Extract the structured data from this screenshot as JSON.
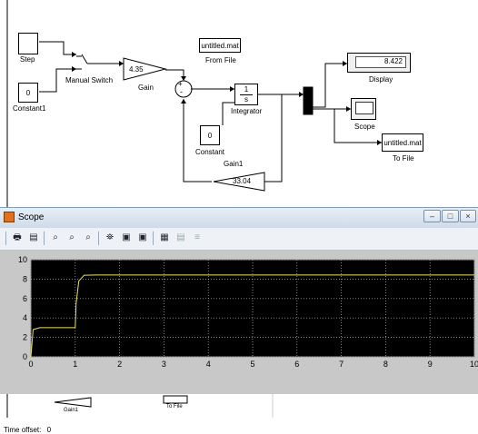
{
  "diagram": {
    "blocks": {
      "step": "Step",
      "constant1_value": "0",
      "constant1": "Constant1",
      "manual_switch": "Manual Switch",
      "gain_value": "4.35",
      "gain": "Gain",
      "from_file_value": "untitled.mat",
      "from_file": "From File",
      "integrator_num": "1",
      "integrator_den": "s",
      "integrator": "Integrator",
      "constant_value": "0",
      "constant": "Constant",
      "gain1_value": "33.04",
      "gain1": "Gain1",
      "display_value": "8.422",
      "display": "Display",
      "scope": "Scope",
      "to_file_value": "untitled.mat",
      "to_file": "To File"
    }
  },
  "scope_window": {
    "title": "Scope",
    "buttons": {
      "minimize": "–",
      "maximize": "□",
      "close": "×"
    },
    "time_offset_label": "Time offset:",
    "time_offset_value": "0"
  },
  "toolbar_icons": [
    "print-icon",
    "parameters-icon",
    "zoom-icon",
    "zoom-x-icon",
    "zoom-y-icon",
    "autoscale-icon",
    "save-axes-icon",
    "restore-axes-icon",
    "floating-scope-icon",
    "lock-axes-icon",
    "signal-selection-icon"
  ],
  "bottom_strip": {
    "gain1": "Gain1",
    "to_file": "To File"
  },
  "chart_data": {
    "type": "line",
    "xlim": [
      0,
      10
    ],
    "ylim": [
      0,
      10
    ],
    "xticks": [
      "0",
      "1",
      "2",
      "3",
      "4",
      "5",
      "6",
      "7",
      "8",
      "9",
      "10"
    ],
    "yticks": [
      "0",
      "2",
      "4",
      "6",
      "8",
      "10"
    ],
    "grid": true,
    "series": [
      {
        "color": "#f0e060",
        "x": [
          0,
          0.05,
          0.2,
          1.0,
          1.02,
          1.08,
          1.2,
          1.5,
          10
        ],
        "y": [
          0,
          2.8,
          3.0,
          3.0,
          5.5,
          7.8,
          8.4,
          8.42,
          8.42
        ]
      }
    ]
  }
}
